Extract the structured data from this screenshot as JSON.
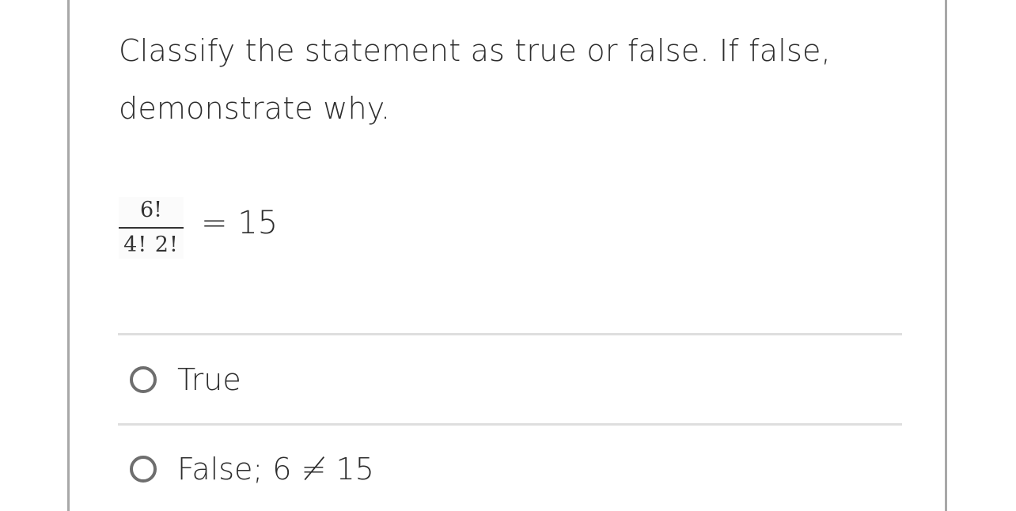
{
  "question": {
    "text": "Classify the statement as true or false. If false, demonstrate why."
  },
  "expression": {
    "numerator": "6!",
    "denominator": "4! 2!",
    "rhs": "= 15"
  },
  "options": [
    {
      "label": "True",
      "selected": false
    },
    {
      "label": "False; 6 ≠ 15",
      "selected": false
    }
  ],
  "colors": {
    "text": "#2d2d2d",
    "border": "#a8a8a8",
    "divider": "#dedede",
    "radio": "#6e6e6e"
  },
  "icons": {
    "radio": "radio-button-unchecked-icon"
  }
}
